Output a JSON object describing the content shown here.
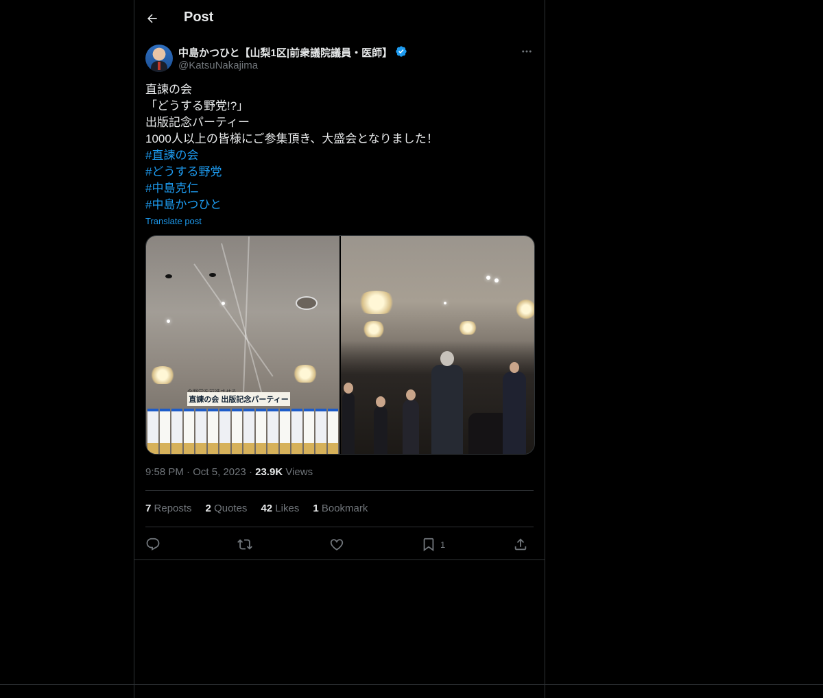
{
  "header": {
    "title": "Post"
  },
  "author": {
    "display_name": "中島かつひと【山梨1区|前衆議院議員・医師】",
    "handle": "@KatsuNakajima",
    "verified": true
  },
  "tweet": {
    "lines": [
      "直諫の会",
      "「どうする野党!?」",
      "出版記念パーティー",
      "1000人以上の皆様にご参集頂き、大盛会となりました！"
    ],
    "hashtags": [
      "#直諫の会",
      "#どうする野党",
      "#中島克仁",
      "#中島かつひと"
    ],
    "translate_label": "Translate post"
  },
  "media": {
    "banner_small": "今野党を前進させる",
    "banner_text": "直諫の会 出版記念パーティー"
  },
  "meta": {
    "time": "9:58 PM",
    "date": "Oct 5, 2023",
    "views_count": "23.9K",
    "views_label": "Views"
  },
  "stats": {
    "reposts_count": "7",
    "reposts_label": "Reposts",
    "quotes_count": "2",
    "quotes_label": "Quotes",
    "likes_count": "42",
    "likes_label": "Likes",
    "bookmarks_count": "1",
    "bookmarks_label": "Bookmark"
  },
  "actions": {
    "bookmark_count": "1"
  },
  "colors": {
    "accent": "#1d9bf0",
    "muted": "#71767b",
    "text": "#e7e9ea",
    "border": "#2f3336",
    "background": "#000000"
  },
  "icons": [
    "back-arrow-icon",
    "verified-badge-icon",
    "more-icon",
    "reply-icon",
    "repost-icon",
    "like-icon",
    "bookmark-icon",
    "share-icon"
  ]
}
